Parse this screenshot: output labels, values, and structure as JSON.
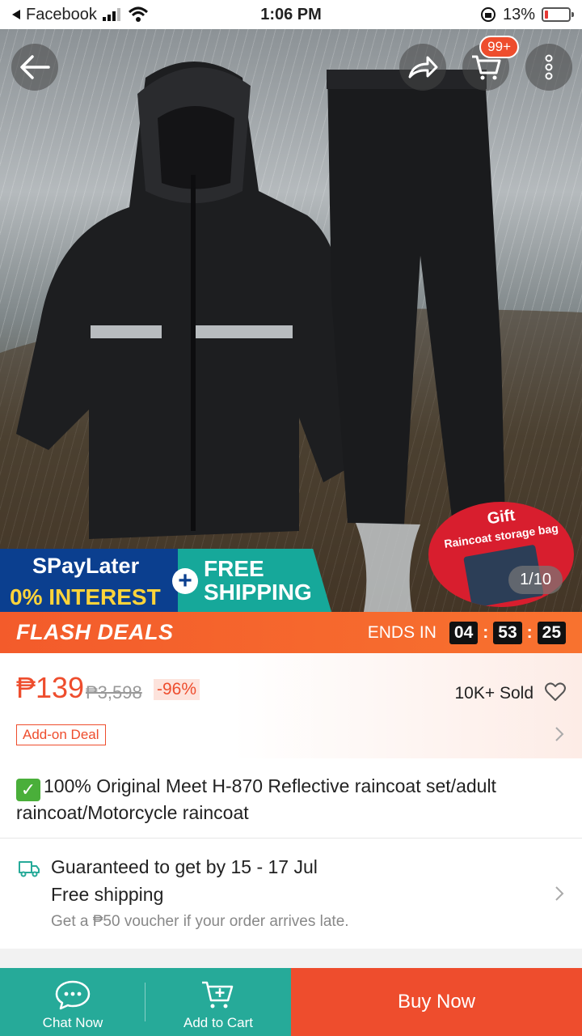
{
  "status_bar": {
    "back_app": "Facebook",
    "time": "1:06 PM",
    "battery": "13%",
    "battery_level": 0.13
  },
  "hero": {
    "cart_badge": "99+",
    "image_counter": "1/10",
    "promo": {
      "spaylater": "SPayLater",
      "interest": "0% INTEREST",
      "free_line1": "FREE",
      "free_line2": "SHIPPING"
    },
    "gift": {
      "title": "Gift",
      "subtitle": "Raincoat storage bag"
    }
  },
  "flash_deals": {
    "title": "FLASH DEALS",
    "ends_in": "ENDS IN",
    "hours": "04",
    "minutes": "53",
    "seconds": "25"
  },
  "price": {
    "current": "₱139",
    "original": "₱3,598",
    "discount": "-96%",
    "sold": "10K+ Sold",
    "addon": "Add-on Deal"
  },
  "product": {
    "title": "100% Original Meet H-870 Reflective raincoat set/adult raincoat/Motorcycle raincoat"
  },
  "shipping": {
    "guarantee": "Guaranteed to get by 15 - 17 Jul",
    "free": "Free shipping",
    "voucher": "Get a ₱50 voucher if your order arrives late."
  },
  "bottom_bar": {
    "chat": "Chat Now",
    "add_to_cart": "Add to Cart",
    "buy_now": "Buy Now"
  },
  "colors": {
    "brand": "#ee4d2d",
    "teal": "#26aa99"
  }
}
